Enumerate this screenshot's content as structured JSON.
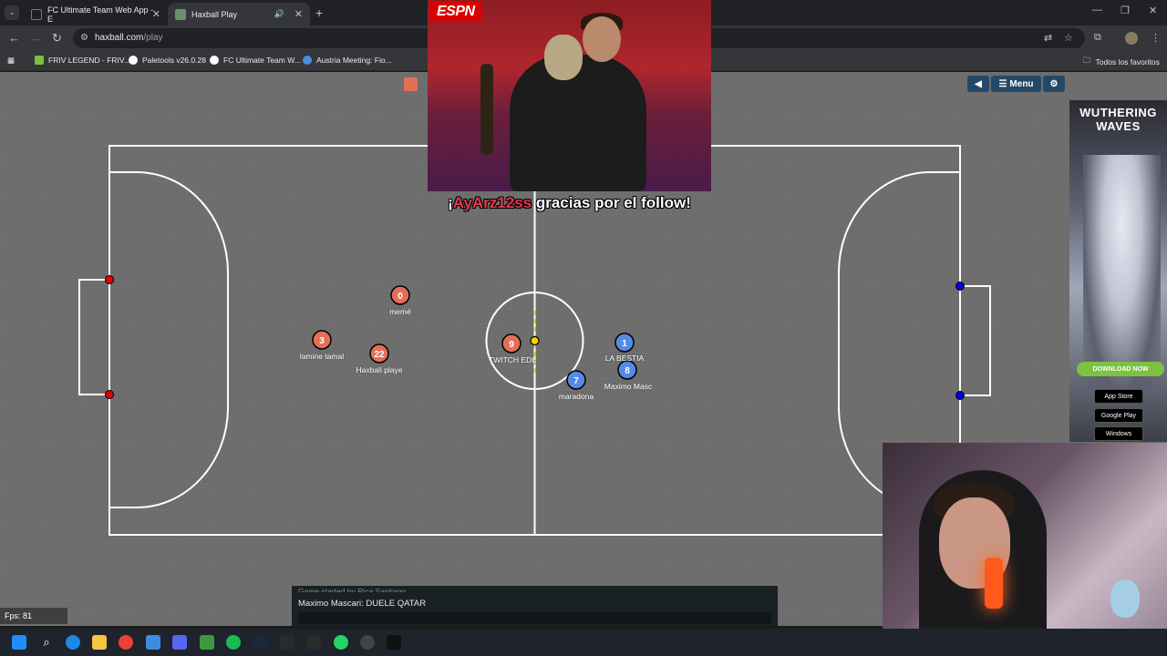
{
  "browser": {
    "tabs": [
      {
        "title": "FC Ultimate Team Web App - E",
        "active": false,
        "favicon_color": "#1f1f1f"
      },
      {
        "title": "Haxball Play",
        "active": true,
        "favicon_color": "#6b8f6b"
      }
    ],
    "url_host": "haxball.com",
    "url_path": "/play",
    "bookmarks": [
      {
        "label": "FRIV LEGEND - FRIV...",
        "icon_color": "#7bc043"
      },
      {
        "label": "Paletools v26.0.28",
        "icon_color": "#ffffff"
      },
      {
        "label": "FC Ultimate Team W...",
        "icon_color": "#ffffff"
      },
      {
        "label": "Austria Meeting: Fio...",
        "icon_color": "#4a90e2"
      }
    ],
    "all_bookmarks_label": "Todos los favoritos"
  },
  "game": {
    "menu_label": "Menu",
    "team_colors": {
      "red": "#e56e56",
      "blue": "#5689e5"
    },
    "players": [
      {
        "team": "red",
        "number": "0",
        "name": "memé"
      },
      {
        "team": "red",
        "number": "3",
        "name": "lamine tamal"
      },
      {
        "team": "red",
        "number": "22",
        "name": "Haxball playe"
      },
      {
        "team": "red",
        "number": "9",
        "name": "TWITCH EDL"
      },
      {
        "team": "blue",
        "number": "1",
        "name": "LA BESTIA"
      },
      {
        "team": "blue",
        "number": "8",
        "name": "Maximo Masc"
      },
      {
        "team": "blue",
        "number": "7",
        "name": "maradona"
      }
    ]
  },
  "stream": {
    "espn_logo": "ESPN",
    "follow_prefix": "¡",
    "follow_name": "AyArz12ss",
    "follow_suffix": " gracias por el follow!"
  },
  "ad": {
    "title_line1": "WUTHERING",
    "title_line2": "WAVES",
    "download_label": "DOWNLOAD NOW",
    "stores": [
      "App Store",
      "Google Play",
      "Windows"
    ]
  },
  "chat": {
    "previous_message": "Game started by Rica Santiago",
    "last_message": "Maximo Mascari: DUELE QATAR"
  },
  "fps_label": "Fps: 81"
}
